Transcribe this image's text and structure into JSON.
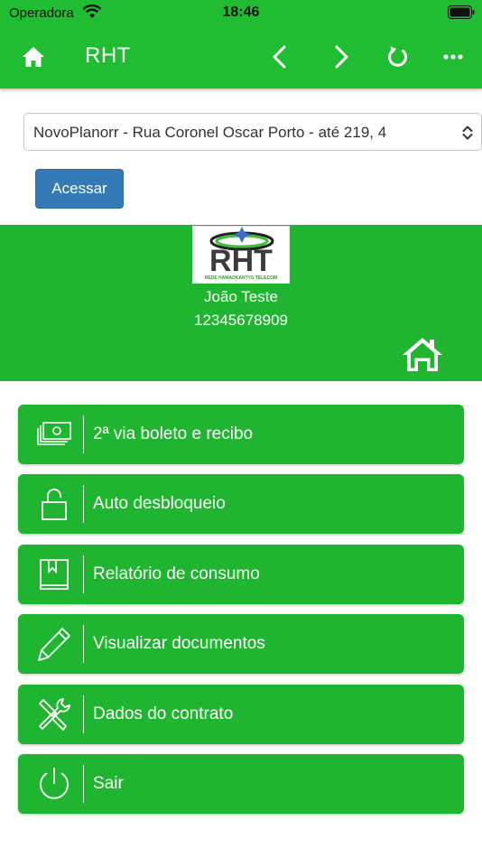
{
  "status_bar": {
    "carrier": "Operadora",
    "time": "18:46"
  },
  "nav": {
    "title": "RHT"
  },
  "plan_select": {
    "value": "NovoPlanorr - Rua Coronel Oscar Porto - até 219, 4"
  },
  "access_button": {
    "label": "Acessar"
  },
  "logo": {
    "letters": "RHT",
    "tagline": "REDE HAMADKANTYS TELECOM"
  },
  "profile": {
    "name": "João Teste",
    "document": "12345678909"
  },
  "menu": [
    {
      "label": "2ª via boleto e recibo",
      "icon": "money-icon"
    },
    {
      "label": "Auto desbloqueio",
      "icon": "unlock-icon"
    },
    {
      "label": "Relatório de consumo",
      "icon": "book-icon"
    },
    {
      "label": "Visualizar documentos",
      "icon": "pencil-icon"
    },
    {
      "label": "Dados do contrato",
      "icon": "tools-icon"
    },
    {
      "label": "Sair",
      "icon": "power-icon"
    }
  ],
  "colors": {
    "brand_green": "#20bd32",
    "button_blue": "#337ab7"
  }
}
